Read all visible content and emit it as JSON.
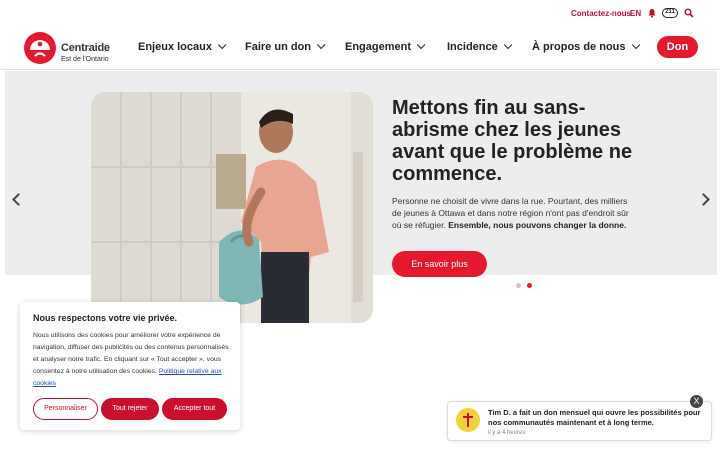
{
  "topbar": {
    "contact": "Contactez-nous",
    "lang": "EN",
    "badge": "211",
    "icons": [
      "bell-icon",
      "search-icon"
    ]
  },
  "brand": {
    "name": "Centraide",
    "subtitle": "Est de l'Ontario"
  },
  "nav": {
    "items": [
      {
        "label": "Enjeux locaux"
      },
      {
        "label": "Faire un don"
      },
      {
        "label": "Engagement"
      },
      {
        "label": "Incidence"
      },
      {
        "label": "À propos de nous"
      }
    ],
    "donate": "Don"
  },
  "hero": {
    "title": "Mettons fin au sans-abrisme chez les jeunes avant que le problème ne commence.",
    "text": "Personne ne choisit de vivre dans la rue. Pourtant, des milliers de jeunes à Ottawa et dans notre région n'ont pas d'endroit sûr où se réfugier.",
    "text_bold": "Ensemble, nous pouvons changer la donne.",
    "cta": "En savoir plus",
    "slide_current": 2,
    "slide_total": 2
  },
  "cookie": {
    "title": "Nous respectons votre vie privée.",
    "body": "Nous utilisons des cookies pour améliorer votre expérience de navigation, diffuser des publicités ou des contenus personnalisés et analyser notre trafic. En cliquant sur « Tout accepter », vous consentez à notre utilisation des cookies.",
    "link": "Politique relative aux cookies",
    "btn_customize": "Personnaliser",
    "btn_reject": "Tout rejeter",
    "btn_accept": "Accepter tout"
  },
  "notification": {
    "message": "Tim D. a fait un don mensuel qui ouvre les possibilités pour nos communautés maintenant et à long terme.",
    "time": "il y a 4 heures",
    "close": "X"
  },
  "colors": {
    "brand_red": "#e5192e",
    "dark_red": "#c8102e",
    "hero_bg": "#ededed"
  }
}
